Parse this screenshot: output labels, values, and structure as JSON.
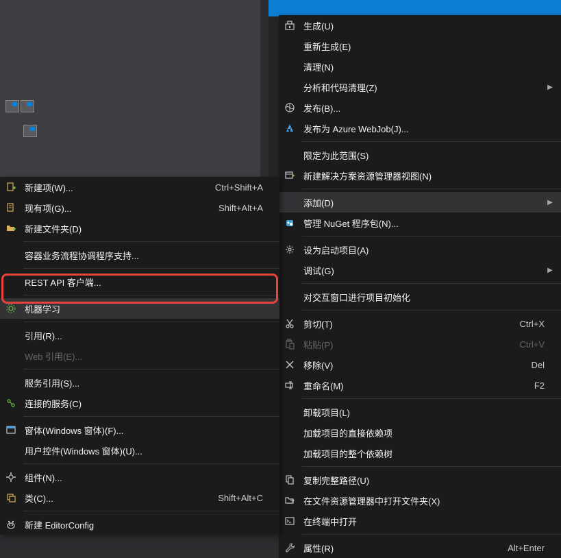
{
  "rightMenu": {
    "items": [
      {
        "icon": "build-icon",
        "label": "生成(U)"
      },
      {
        "icon": "",
        "label": "重新生成(E)"
      },
      {
        "icon": "",
        "label": "清理(N)"
      },
      {
        "icon": "",
        "label": "分析和代码清理(Z)",
        "arrow": true
      },
      {
        "icon": "publish-icon",
        "label": "发布(B)..."
      },
      {
        "icon": "azure-icon",
        "label": "发布为 Azure WebJob(J)..."
      },
      {
        "sep": true
      },
      {
        "icon": "",
        "label": "限定为此范围(S)"
      },
      {
        "icon": "new-view-icon",
        "label": "新建解决方案资源管理器视图(N)"
      },
      {
        "sep": true
      },
      {
        "icon": "",
        "label": "添加(D)",
        "arrow": true,
        "highlighted": true
      },
      {
        "icon": "nuget-icon",
        "label": "管理 NuGet 程序包(N)..."
      },
      {
        "sep": true
      },
      {
        "icon": "gear-icon",
        "label": "设为启动项目(A)"
      },
      {
        "icon": "",
        "label": "调试(G)",
        "arrow": true
      },
      {
        "sep": true
      },
      {
        "icon": "",
        "label": "对交互窗口进行项目初始化"
      },
      {
        "sep": true
      },
      {
        "icon": "cut-icon",
        "label": "剪切(T)",
        "shortcut": "Ctrl+X"
      },
      {
        "icon": "paste-icon",
        "label": "粘贴(P)",
        "shortcut": "Ctrl+V",
        "disabled": true
      },
      {
        "icon": "remove-icon",
        "label": "移除(V)",
        "shortcut": "Del"
      },
      {
        "icon": "rename-icon",
        "label": "重命名(M)",
        "shortcut": "F2"
      },
      {
        "sep": true
      },
      {
        "icon": "",
        "label": "卸载项目(L)"
      },
      {
        "icon": "",
        "label": "加载项目的直接依赖项"
      },
      {
        "icon": "",
        "label": "加载项目的整个依赖树"
      },
      {
        "sep": true
      },
      {
        "icon": "copy-path-icon",
        "label": "复制完整路径(U)"
      },
      {
        "icon": "open-folder-icon",
        "label": "在文件资源管理器中打开文件夹(X)"
      },
      {
        "icon": "terminal-icon",
        "label": "在终端中打开"
      },
      {
        "sep": true
      },
      {
        "icon": "wrench-icon",
        "label": "属性(R)",
        "shortcut": "Alt+Enter"
      }
    ]
  },
  "leftMenu": {
    "items": [
      {
        "icon": "new-item-icon",
        "label": "新建项(W)...",
        "shortcut": "Ctrl+Shift+A"
      },
      {
        "icon": "existing-item-icon",
        "label": "现有项(G)...",
        "shortcut": "Shift+Alt+A"
      },
      {
        "icon": "new-folder-icon",
        "label": "新建文件夹(D)"
      },
      {
        "sep": true
      },
      {
        "icon": "",
        "label": "容器业务流程协调程序支持..."
      },
      {
        "sep": true
      },
      {
        "icon": "",
        "label": "REST API 客户端..."
      },
      {
        "sep": true
      },
      {
        "icon": "ml-icon",
        "label": "机器学习",
        "highlighted": true
      },
      {
        "sep": true
      },
      {
        "icon": "",
        "label": "引用(R)..."
      },
      {
        "icon": "",
        "label": "Web 引用(E)...",
        "disabled": true
      },
      {
        "sep": true
      },
      {
        "icon": "",
        "label": "服务引用(S)..."
      },
      {
        "icon": "connected-service-icon",
        "label": "连接的服务(C)"
      },
      {
        "sep": true
      },
      {
        "icon": "form-icon",
        "label": "窗体(Windows 窗体)(F)..."
      },
      {
        "icon": "",
        "label": "用户控件(Windows 窗体)(U)..."
      },
      {
        "sep": true
      },
      {
        "icon": "component-icon",
        "label": "组件(N)..."
      },
      {
        "icon": "class-icon",
        "label": "类(C)...",
        "shortcut": "Shift+Alt+C"
      },
      {
        "sep": true
      },
      {
        "icon": "editorconfig-icon",
        "label": "新建 EditorConfig"
      }
    ]
  }
}
